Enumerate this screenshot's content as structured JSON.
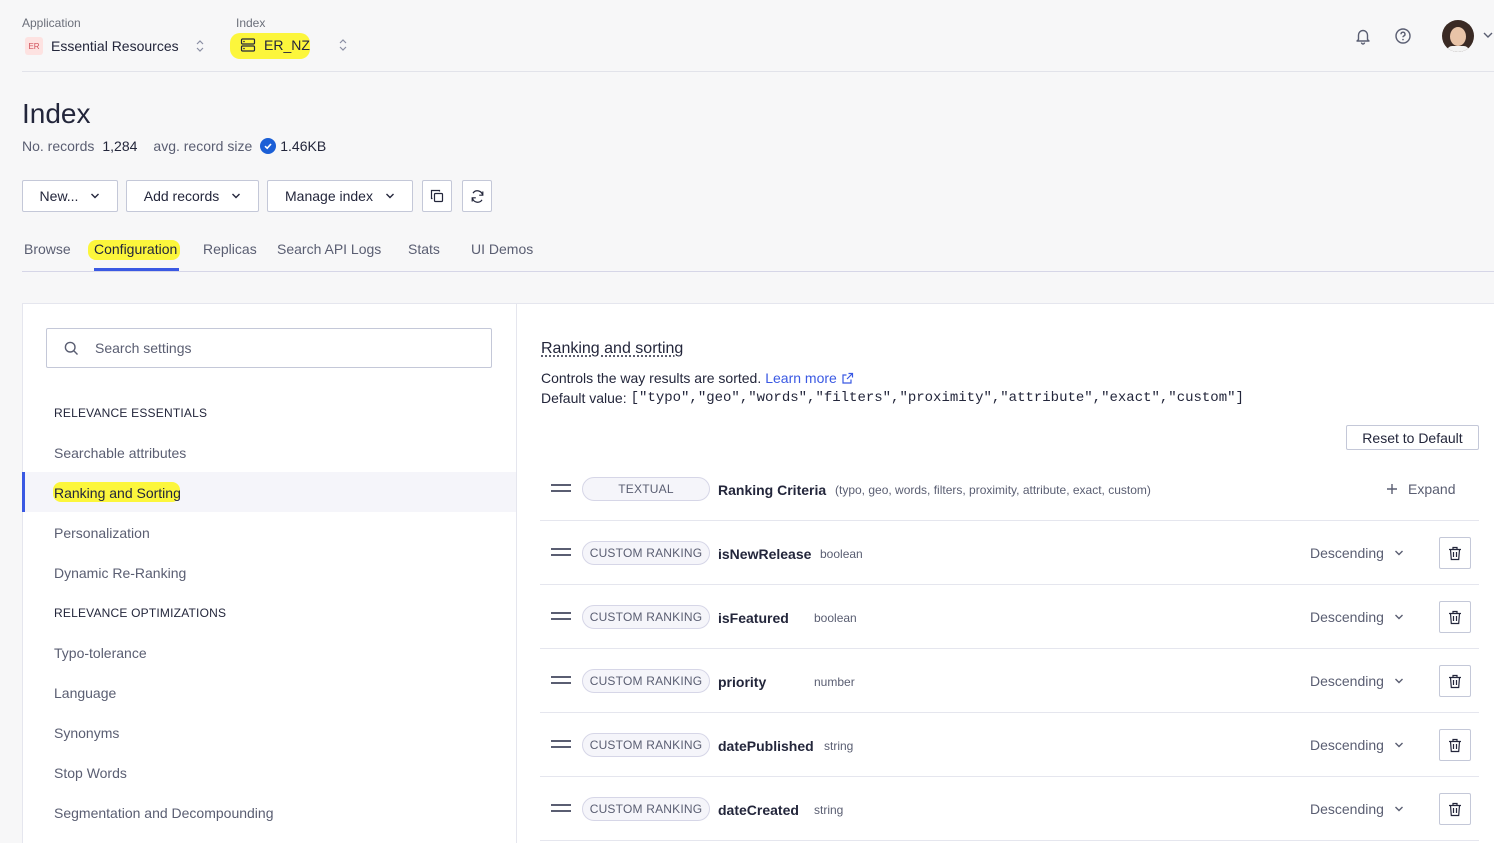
{
  "topbar": {
    "application_label": "Application",
    "application_badge": "ER",
    "application_name": "Essential Resources",
    "index_label": "Index",
    "index_name": "ER_NZ"
  },
  "header": {
    "title": "Index",
    "records_label": "No. records",
    "records_value": "1,284",
    "size_label": "avg. record size",
    "size_value": "1.46KB"
  },
  "actions": {
    "new_label": "New...",
    "add_records_label": "Add records",
    "manage_index_label": "Manage index"
  },
  "tabs": [
    {
      "label": "Browse"
    },
    {
      "label": "Configuration",
      "active": true
    },
    {
      "label": "Replicas"
    },
    {
      "label": "Search API Logs"
    },
    {
      "label": "Stats"
    },
    {
      "label": "UI Demos"
    }
  ],
  "sidebar": {
    "search_placeholder": "Search settings",
    "sections": [
      {
        "title": "RELEVANCE ESSENTIALS",
        "items": [
          "Searchable attributes",
          "Ranking and Sorting",
          "Personalization",
          "Dynamic Re-Ranking"
        ]
      },
      {
        "title": "RELEVANCE OPTIMIZATIONS",
        "items": [
          "Typo-tolerance",
          "Language",
          "Synonyms",
          "Stop Words",
          "Segmentation and Decompounding"
        ]
      }
    ],
    "active_item": "Ranking and Sorting"
  },
  "main": {
    "title": "Ranking and sorting",
    "description": "Controls the way results are sorted.",
    "learn_more": "Learn more",
    "default_label": "Default value:",
    "default_value": "[\"typo\",\"geo\",\"words\",\"filters\",\"proximity\",\"attribute\",\"exact\",\"custom\"]",
    "reset_label": "Reset to Default",
    "textual_row": {
      "pill": "TEXTUAL",
      "name": "Ranking Criteria",
      "detail": "(typo, geo, words, filters, proximity, attribute, exact, custom)",
      "expand_label": "Expand"
    },
    "custom_rows": [
      {
        "pill": "CUSTOM RANKING",
        "name": "isNewRelease",
        "type": "boolean",
        "order": "Descending"
      },
      {
        "pill": "CUSTOM RANKING",
        "name": "isFeatured",
        "type": "boolean",
        "order": "Descending"
      },
      {
        "pill": "CUSTOM RANKING",
        "name": "priority",
        "type": "number",
        "order": "Descending"
      },
      {
        "pill": "CUSTOM RANKING",
        "name": "datePublished",
        "type": "string",
        "order": "Descending"
      },
      {
        "pill": "CUSTOM RANKING",
        "name": "dateCreated",
        "type": "string",
        "order": "Descending"
      }
    ]
  },
  "colors": {
    "accent": "#3a59e3",
    "highlight": "#fcf63c",
    "verified": "#1b5fd6"
  }
}
